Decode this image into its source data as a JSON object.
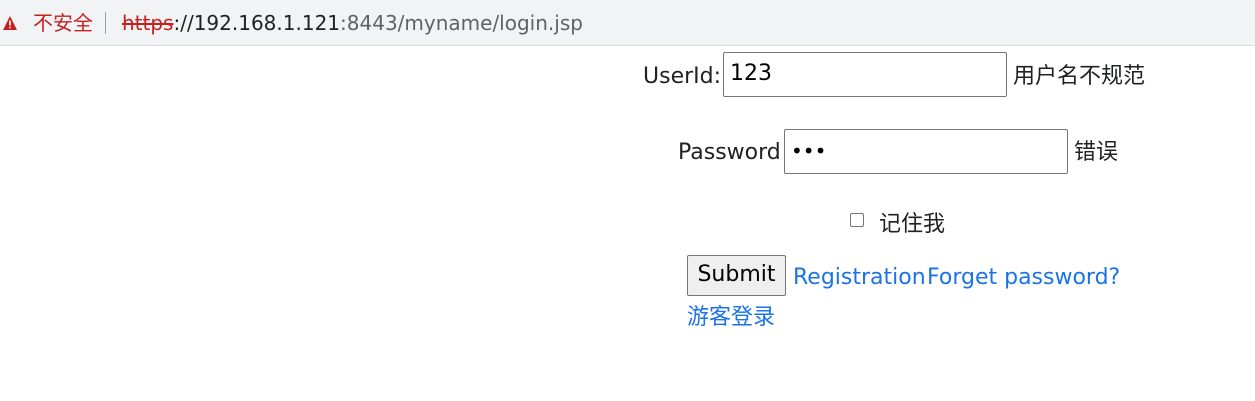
{
  "browser": {
    "security_label": "不安全",
    "url_scheme": "https",
    "url_host_prefix": "://192.168.1.121",
    "url_rest": ":8443/myname/login.jsp"
  },
  "form": {
    "userid_label": "UserId:",
    "userid_value": "123",
    "userid_error": "用户名不规范",
    "password_label": "Password",
    "password_mask": "•••",
    "password_error": "错误",
    "remember_label": "记住我",
    "remember_checked": false,
    "submit_label": "Submit",
    "registration_link": "Registration",
    "forgot_link": "Forget password?",
    "guest_link": "游客登录"
  },
  "colors": {
    "link": "#1a73e8",
    "insecure": "#c5221f"
  }
}
